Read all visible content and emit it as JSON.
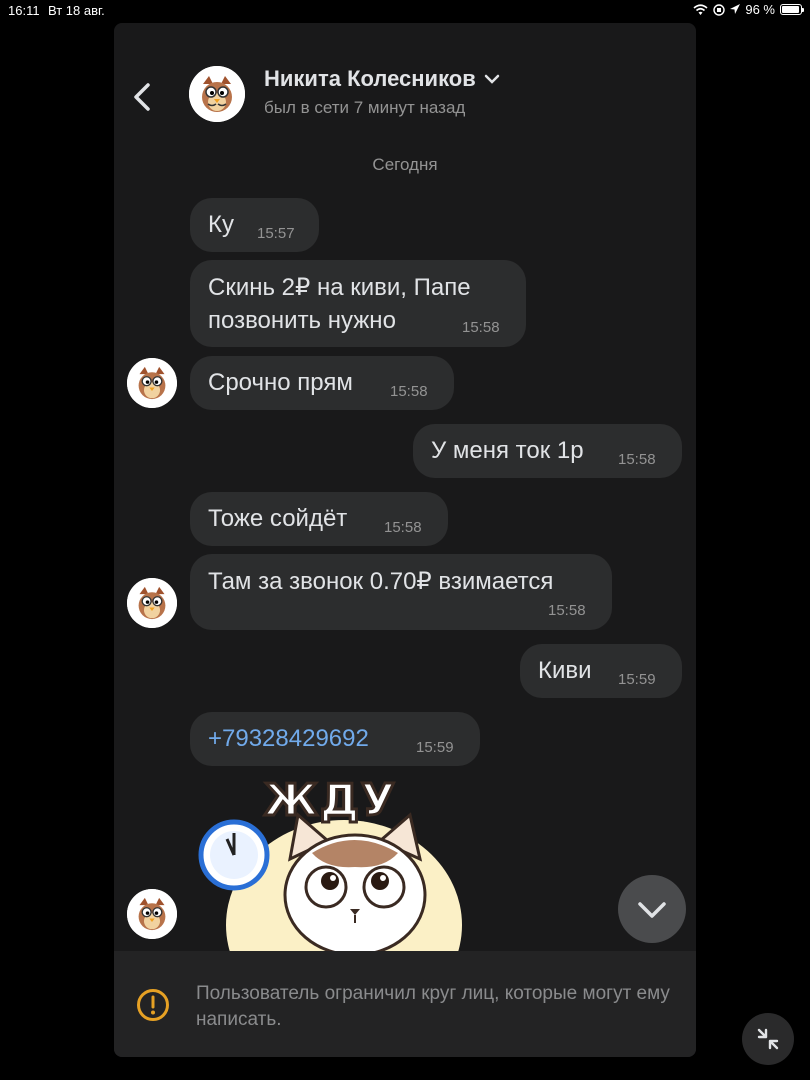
{
  "status_bar": {
    "time": "16:11",
    "date": "Вт 18 авг.",
    "battery": "96 %"
  },
  "header": {
    "contact_name": "Никита Колесников",
    "contact_status": "был в сети 7 минут назад"
  },
  "date_separator": "Сегодня",
  "messages": [
    {
      "text": "Ку",
      "time": "15:57"
    },
    {
      "text_line1": "Скинь 2₽ на киви, Папе",
      "text_line2": "позвонить нужно",
      "time": "15:58"
    },
    {
      "text": "Срочно прям",
      "time": "15:58"
    },
    {
      "text": "У меня ток 1р",
      "time": "15:58"
    },
    {
      "text": "Тоже сойдёт",
      "time": "15:58"
    },
    {
      "text": "Там за звонок 0.70₽ взимается",
      "time": "15:58"
    },
    {
      "text": "Киви",
      "time": "15:59"
    },
    {
      "text": "+79328429692",
      "time": "15:59"
    }
  ],
  "sticker": {
    "caption": "ЖДУ"
  },
  "notice": {
    "text": "Пользователь ограничил круг лиц, которые могут ему написать."
  },
  "colors": {
    "background": "#19191a",
    "bubble": "#2c2d2e",
    "link": "#71aaeb",
    "muted": "#939393"
  }
}
